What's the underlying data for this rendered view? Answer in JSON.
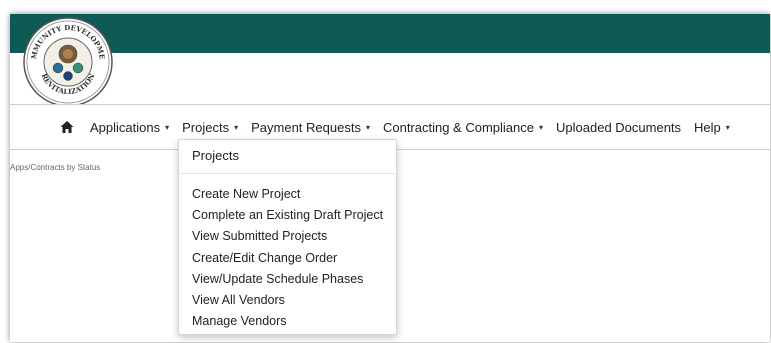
{
  "colors": {
    "header_band": "#0e5a55",
    "text": "#222222"
  },
  "logo": {
    "top_text": "COMMUNITY DEVELOPMENT",
    "bottom_text": "REVITALIZATION"
  },
  "nav": {
    "home_icon": "home-icon",
    "items": [
      {
        "label": "Applications",
        "has_caret": true
      },
      {
        "label": "Projects",
        "has_caret": true
      },
      {
        "label": "Payment Requests",
        "has_caret": true
      },
      {
        "label": "Contracting & Compliance",
        "has_caret": true
      },
      {
        "label": "Uploaded Documents",
        "has_caret": false
      },
      {
        "label": "Help",
        "has_caret": true
      }
    ],
    "caret_glyph": "▾"
  },
  "breadcrumb": "Apps/Contracts by Status",
  "dropdown": {
    "header": "Projects",
    "items": [
      "Create New Project",
      "Complete an Existing Draft Project",
      "View Submitted Projects",
      "Create/Edit Change Order",
      "View/Update Schedule Phases",
      "View All Vendors",
      "Manage Vendors"
    ]
  }
}
